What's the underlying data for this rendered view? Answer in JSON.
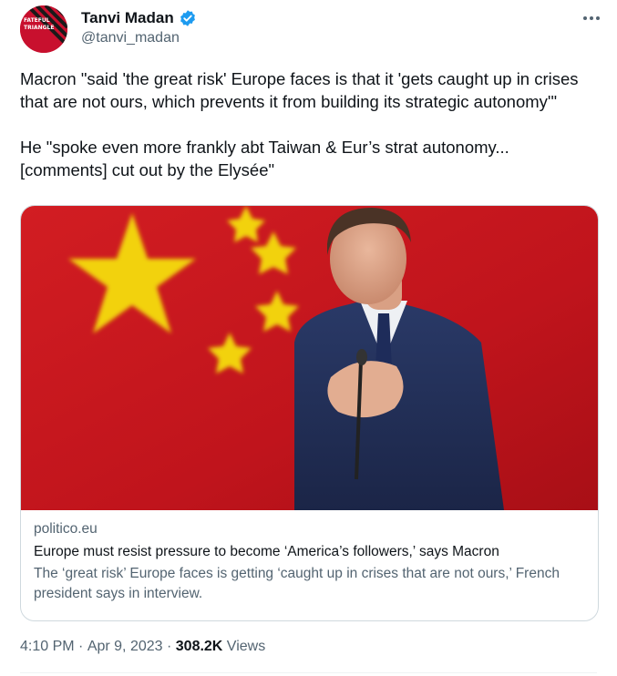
{
  "author": {
    "display_name": "Tanvi Madan",
    "handle": "@tanvi_madan",
    "avatar_text_line1": "FATEFUL",
    "avatar_text_line2": "TRIANGLE"
  },
  "tweet": {
    "paragraphs": [
      "Macron \"said 'the great risk' Europe faces is that it 'gets caught up in crises that are not ours, which prevents it from building its strategic autonomy'\"",
      "He \"spoke even more frankly abt Taiwan & Eur’s strat autonomy... [comments] cut out by the Elysée\""
    ]
  },
  "card": {
    "domain": "politico.eu",
    "title": "Europe must resist pressure to become ‘America’s followers,’ says Macron",
    "description": "The ‘great risk’ Europe faces is getting ‘caught up in crises that are not ours,’ French president says in interview."
  },
  "meta": {
    "time": "4:10 PM",
    "separator": " · ",
    "date": "Apr 9, 2023",
    "separator2": " · ",
    "views_count": "308.2K",
    "views_label": " Views"
  },
  "colors": {
    "flag_red": "#c8102e",
    "star_yellow": "#ffde00",
    "link_blue": "#1d9bf0"
  }
}
